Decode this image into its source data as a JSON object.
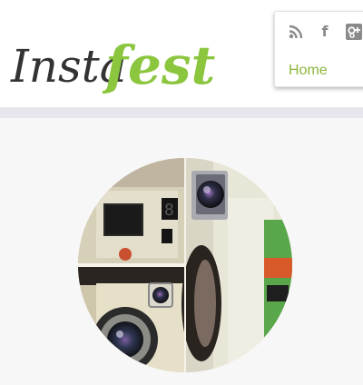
{
  "header": {
    "logo": {
      "part1": "Insta",
      "part2": "fest",
      "color1": "#333333",
      "color2": "#8cc63f"
    }
  },
  "social": [
    {
      "icon": "rss-icon"
    },
    {
      "icon": "facebook-icon",
      "glyph": "f"
    },
    {
      "icon": "google-plus-icon"
    }
  ],
  "nav": {
    "home_label": "Home",
    "accent": "#8cb63c"
  },
  "hero": {
    "image": "instafest-camera-collage"
  }
}
